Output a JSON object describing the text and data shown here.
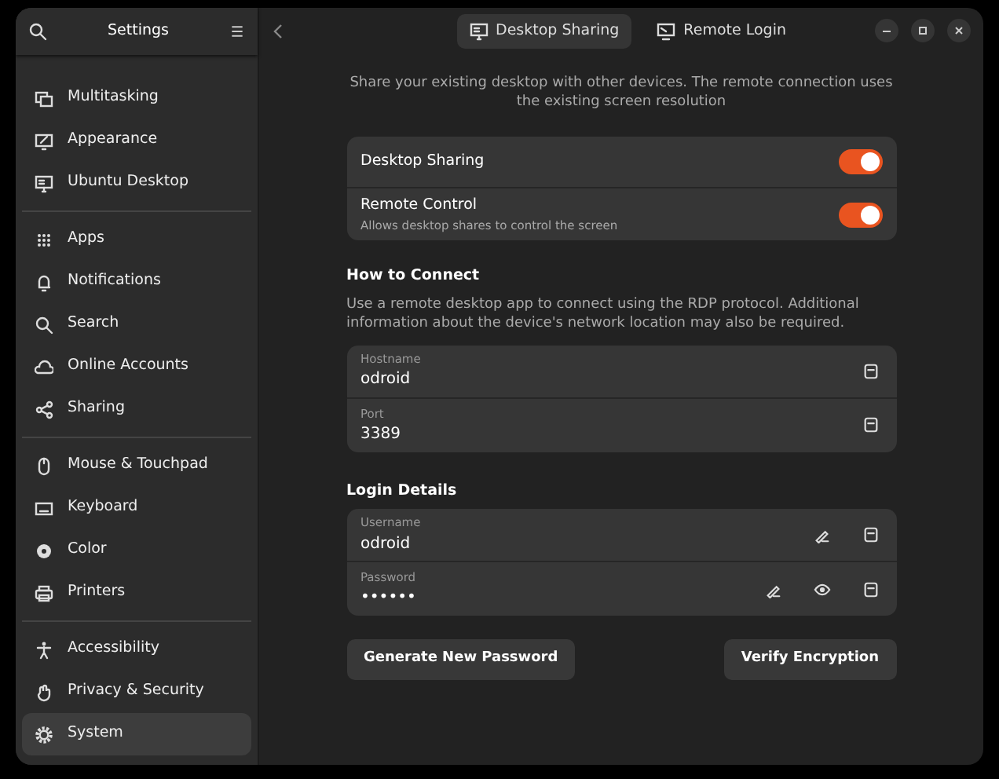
{
  "sidebar": {
    "title": "Settings",
    "groups": [
      [
        {
          "label": "Multitasking",
          "selected": false
        },
        {
          "label": "Appearance",
          "selected": false
        },
        {
          "label": "Ubuntu Desktop",
          "selected": false
        }
      ],
      [
        {
          "label": "Apps",
          "selected": false
        },
        {
          "label": "Notifications",
          "selected": false
        },
        {
          "label": "Search",
          "selected": false
        },
        {
          "label": "Online Accounts",
          "selected": false
        },
        {
          "label": "Sharing",
          "selected": false
        }
      ],
      [
        {
          "label": "Mouse & Touchpad",
          "selected": false
        },
        {
          "label": "Keyboard",
          "selected": false
        },
        {
          "label": "Color",
          "selected": false
        },
        {
          "label": "Printers",
          "selected": false
        }
      ],
      [
        {
          "label": "Accessibility",
          "selected": false
        },
        {
          "label": "Privacy & Security",
          "selected": false
        },
        {
          "label": "System",
          "selected": true
        }
      ]
    ]
  },
  "tabs": [
    {
      "label": "Desktop Sharing",
      "selected": true
    },
    {
      "label": "Remote Login",
      "selected": false
    }
  ],
  "description": "Share your existing desktop with other devices. The remote connection uses the existing screen resolution",
  "toggles": [
    {
      "label": "Desktop Sharing",
      "on": true
    },
    {
      "label": "Remote Control",
      "subtitle": "Allows desktop shares to control the screen",
      "on": true
    }
  ],
  "sections": [
    {
      "title": "How to Connect",
      "description": "Use a remote desktop app to connect using the RDP protocol. Additional information about the device's network location may also be required.",
      "fields": [
        {
          "label": "Hostname",
          "value": "odroid",
          "actions": [
            {
              "kind": "copy"
            }
          ]
        },
        {
          "label": "Port",
          "value": "3389",
          "actions": [
            {
              "kind": "copy"
            }
          ]
        }
      ]
    },
    {
      "title": "Login Details",
      "fields": [
        {
          "label": "Username",
          "value": "odroid",
          "actions": [
            {
              "kind": "edit"
            },
            {
              "kind": "copy"
            }
          ]
        },
        {
          "label": "Password",
          "value": "••••••",
          "actions": [
            {
              "kind": "edit"
            },
            {
              "kind": "reveal"
            },
            {
              "kind": "copy"
            }
          ]
        }
      ]
    }
  ],
  "buttons": [
    "Generate New Password",
    "Verify Encryption"
  ]
}
